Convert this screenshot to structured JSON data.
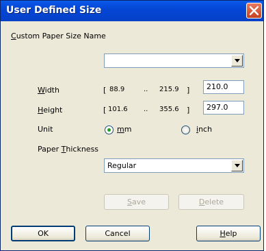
{
  "window": {
    "title": "User Defined Size"
  },
  "custom_name": {
    "label_u": "C",
    "label_rest": "ustom Paper Size Name",
    "value": ""
  },
  "width": {
    "label_u": "W",
    "label_rest": "idth",
    "min": "88.9",
    "sep": "..",
    "max": "215.9",
    "open": "[",
    "close": "]",
    "value": "210.0"
  },
  "height": {
    "label_u": "H",
    "label_rest": "eight",
    "min": "101.6",
    "sep": "..",
    "max": "355.6",
    "open": "[",
    "close": "]",
    "value": "297.0"
  },
  "unit": {
    "label": "Unit",
    "mm_u": "m",
    "mm_rest": "m",
    "inch_u": "i",
    "inch_rest": "nch",
    "selected": "mm"
  },
  "thickness": {
    "label_pre": "Paper ",
    "label_u": "T",
    "label_rest": "hickness",
    "value": "Regular"
  },
  "buttons": {
    "save_u": "S",
    "save_rest": "ave",
    "delete_u": "D",
    "delete_rest": "elete",
    "ok": "OK",
    "cancel": "Cancel",
    "help_u": "H",
    "help_rest": "elp"
  }
}
